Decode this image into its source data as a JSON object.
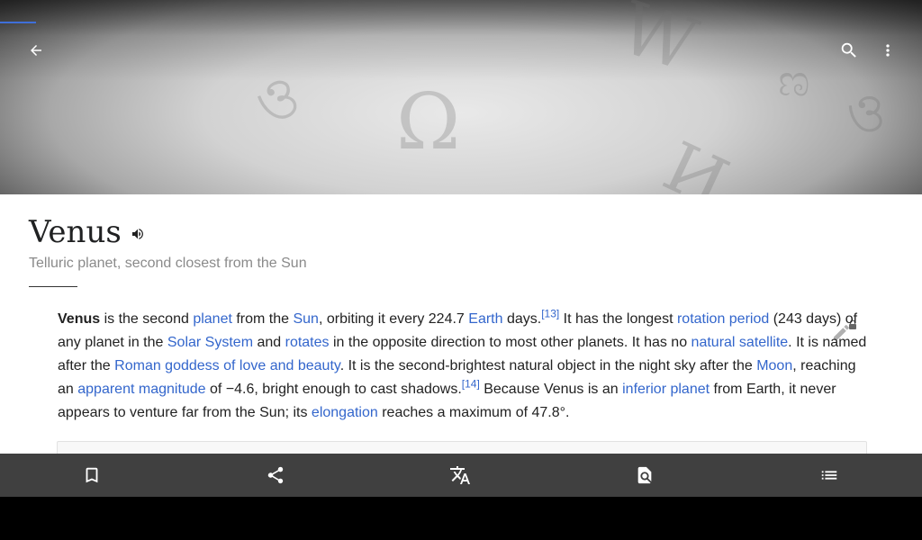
{
  "app_bar": {
    "back_icon": "arrow-back-icon",
    "search_icon": "search-icon",
    "overflow_icon": "more-vert-icon",
    "accent_color": "#3f6fd9"
  },
  "hero": {
    "glyphs": [
      "Ω",
      "W",
      "ও",
      "И",
      "ও",
      "ಣ"
    ]
  },
  "article": {
    "title": "Venus",
    "description": "Telluric planet, second closest from the Sun",
    "link_color": "#3366cc",
    "paragraph": {
      "bold_term": "Venus",
      "t1": " is the second ",
      "l_planet": "planet",
      "t2": " from the ",
      "l_sun": "Sun",
      "t3": ", orbiting it every 224.7 ",
      "l_earth": "Earth",
      "t4": " days.",
      "ref13": "[13]",
      "t5": " It has the longest ",
      "l_rotation": "rotation period",
      "t6": " (243 days) of any planet in the ",
      "l_solar": "Solar System",
      "t7": " and ",
      "l_rotates": "rotates",
      "t8": " in the opposite direction to most other planets. It has no ",
      "l_natsat": "natural satellite",
      "t9": ". It is named after the ",
      "l_roman": "Roman goddess of love and beauty",
      "t10": ". It is the second-brightest natural object in the night sky after the ",
      "l_moon": "Moon",
      "t11": ", reaching an ",
      "l_apparent": "apparent magnitude",
      "t12": " of −4.6, bright enough to cast shadows.",
      "ref14": "[14]",
      "t13": " Because Venus is an ",
      "l_inferior": "inferior planet",
      "t14": " from Earth, it never appears to venture far from the Sun; its ",
      "l_elongation": "elongation",
      "t15": " reaches a maximum of 47.8°."
    }
  },
  "toolbar": {
    "items": [
      {
        "icon": "bookmark-icon"
      },
      {
        "icon": "share-icon"
      },
      {
        "icon": "translate-icon"
      },
      {
        "icon": "find-in-page-icon"
      },
      {
        "icon": "table-of-contents-icon"
      }
    ]
  }
}
